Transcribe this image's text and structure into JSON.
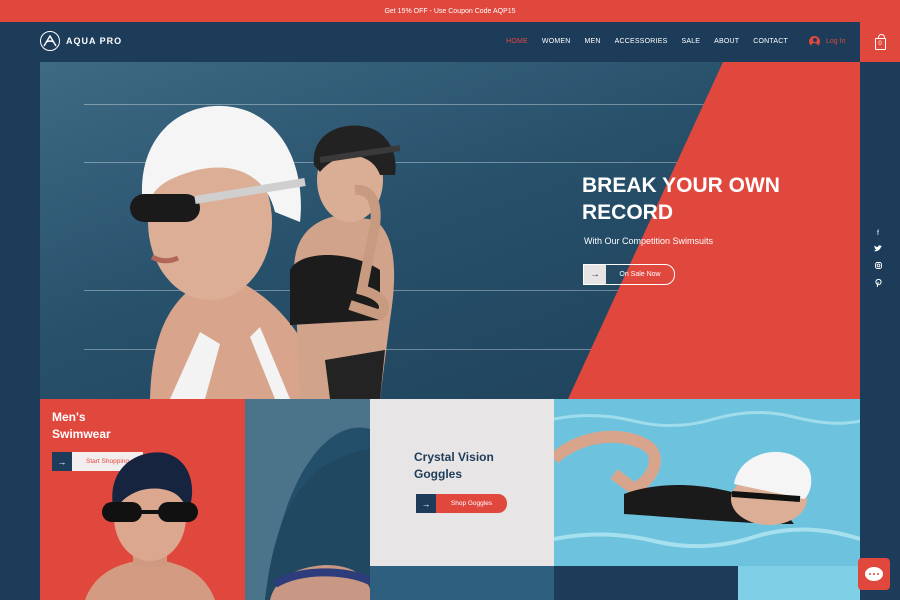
{
  "promo": {
    "text": "Get 15% OFF - Use Coupon Code AQP15"
  },
  "brand": {
    "name": "AQUA PRO",
    "accent": "#e0483e",
    "navy": "#1d3c5a"
  },
  "nav": {
    "items": [
      {
        "label": "HOME",
        "active": true
      },
      {
        "label": "WOMEN"
      },
      {
        "label": "MEN"
      },
      {
        "label": "ACCESSORIES"
      },
      {
        "label": "SALE"
      },
      {
        "label": "ABOUT"
      },
      {
        "label": "CONTACT"
      }
    ],
    "login_label": "Log In",
    "cart_count": "0"
  },
  "hero": {
    "title_line1": "BREAK YOUR OWN",
    "title_line2": "RECORD",
    "subtitle": "With Our Competition Swimsuits",
    "cta_label": "On Sale Now"
  },
  "social": {
    "icons": [
      "facebook-icon",
      "twitter-icon",
      "instagram-icon",
      "pinterest-icon"
    ]
  },
  "tiles": {
    "mens": {
      "title_line1": "Men's",
      "title_line2": "Swimwear",
      "cta_label": "Start Shopping"
    },
    "goggles": {
      "title_line1": "Crystal Vision",
      "title_line2": "Goggles",
      "cta_label": "Shop Goggles"
    }
  }
}
